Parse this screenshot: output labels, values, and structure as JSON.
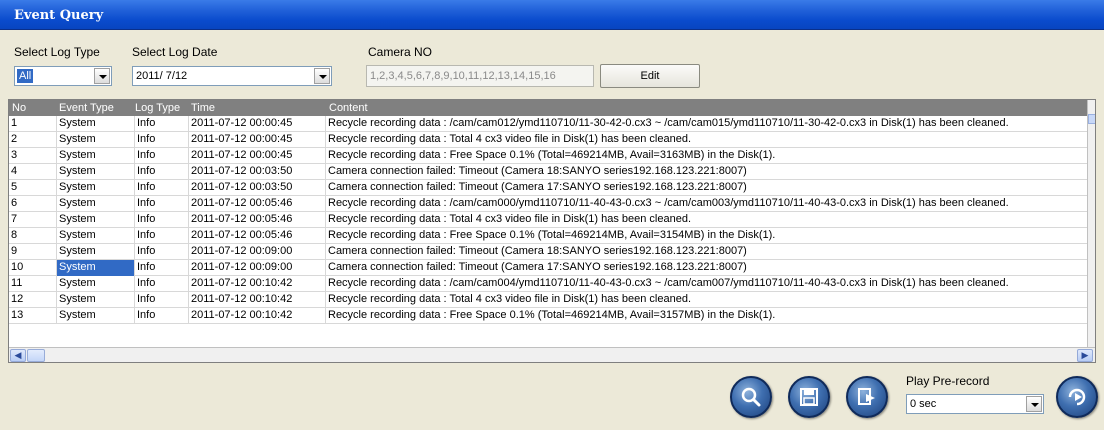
{
  "window": {
    "title": "Event Query"
  },
  "filters": {
    "log_type_label": "Select Log Type",
    "log_type_value": "All",
    "log_date_label": "Select Log Date",
    "log_date_value": "2011/ 7/12",
    "camera_label": "Camera NO",
    "camera_value": "1,2,3,4,5,6,7,8,9,10,11,12,13,14,15,16",
    "edit_button": "Edit"
  },
  "table": {
    "columns": [
      "No",
      "Event Type",
      "Log Type",
      "Time",
      "Content"
    ],
    "rows": [
      {
        "no": "1",
        "event_type": "System",
        "log_type": "Info",
        "time": "2011-07-12 00:00:45",
        "content": "Recycle recording data : /cam/cam012/ymd110710/11-30-42-0.cx3 ~ /cam/cam015/ymd110710/11-30-42-0.cx3 in Disk(1) has been cleaned."
      },
      {
        "no": "2",
        "event_type": "System",
        "log_type": "Info",
        "time": "2011-07-12 00:00:45",
        "content": "Recycle recording data : Total 4 cx3 video file in Disk(1) has been cleaned."
      },
      {
        "no": "3",
        "event_type": "System",
        "log_type": "Info",
        "time": "2011-07-12 00:00:45",
        "content": "Recycle recording data : Free Space 0.1% (Total=469214MB, Avail=3163MB) in the Disk(1)."
      },
      {
        "no": "4",
        "event_type": "System",
        "log_type": "Info",
        "time": "2011-07-12 00:03:50",
        "content": "Camera connection failed: Timeout (Camera 18:SANYO series192.168.123.221:8007)"
      },
      {
        "no": "5",
        "event_type": "System",
        "log_type": "Info",
        "time": "2011-07-12 00:03:50",
        "content": "Camera connection failed: Timeout (Camera 17:SANYO series192.168.123.221:8007)"
      },
      {
        "no": "6",
        "event_type": "System",
        "log_type": "Info",
        "time": "2011-07-12 00:05:46",
        "content": "Recycle recording data : /cam/cam000/ymd110710/11-40-43-0.cx3 ~ /cam/cam003/ymd110710/11-40-43-0.cx3 in Disk(1) has been cleaned."
      },
      {
        "no": "7",
        "event_type": "System",
        "log_type": "Info",
        "time": "2011-07-12 00:05:46",
        "content": "Recycle recording data : Total 4 cx3 video file in Disk(1) has been cleaned."
      },
      {
        "no": "8",
        "event_type": "System",
        "log_type": "Info",
        "time": "2011-07-12 00:05:46",
        "content": "Recycle recording data : Free Space 0.1% (Total=469214MB, Avail=3154MB) in the Disk(1)."
      },
      {
        "no": "9",
        "event_type": "System",
        "log_type": "Info",
        "time": "2011-07-12 00:09:00",
        "content": "Camera connection failed: Timeout (Camera 18:SANYO series192.168.123.221:8007)"
      },
      {
        "no": "10",
        "event_type": "System",
        "log_type": "Info",
        "time": "2011-07-12 00:09:00",
        "content": "Camera connection failed: Timeout (Camera 17:SANYO series192.168.123.221:8007)",
        "selected": true
      },
      {
        "no": "11",
        "event_type": "System",
        "log_type": "Info",
        "time": "2011-07-12 00:10:42",
        "content": "Recycle recording data : /cam/cam004/ymd110710/11-40-43-0.cx3 ~ /cam/cam007/ymd110710/11-40-43-0.cx3 in Disk(1) has been cleaned."
      },
      {
        "no": "12",
        "event_type": "System",
        "log_type": "Info",
        "time": "2011-07-12 00:10:42",
        "content": "Recycle recording data : Total 4 cx3 video file in Disk(1) has been cleaned."
      },
      {
        "no": "13",
        "event_type": "System",
        "log_type": "Info",
        "time": "2011-07-12 00:10:42",
        "content": "Recycle recording data : Free Space 0.1% (Total=469214MB, Avail=3157MB) in the Disk(1)."
      }
    ]
  },
  "playback": {
    "pre_record_label": "Play Pre-record",
    "pre_record_value": "0 sec"
  },
  "icons": {
    "search": "search-icon",
    "save": "save-icon",
    "export": "export-icon",
    "play": "play-icon"
  },
  "colors": {
    "titlebar": "#0a4bcd",
    "selection": "#316ac5",
    "header": "#808080",
    "background": "#ece9d8"
  }
}
